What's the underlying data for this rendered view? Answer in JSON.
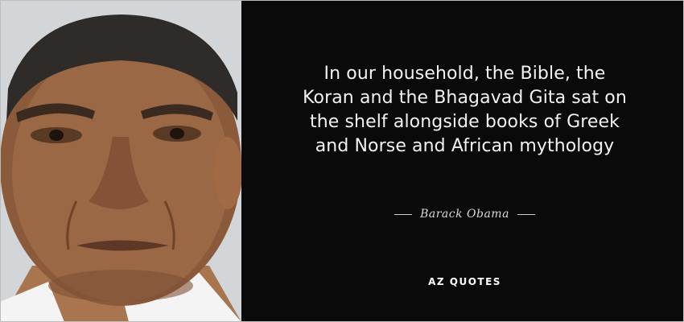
{
  "quote": {
    "lines": [
      "In our household, the Bible, the",
      "Koran and the Bhagavad Gita sat on",
      "the shelf alongside books of Greek",
      "and Norse and African mythology"
    ]
  },
  "author": {
    "name": "Barack Obama"
  },
  "brand": {
    "name": "AZ QUOTES"
  },
  "colors": {
    "background": "#0a0a0a",
    "quote_text": "#f2f2f2",
    "author_text": "#d9d9d9",
    "brand_text": "#ffffff"
  }
}
